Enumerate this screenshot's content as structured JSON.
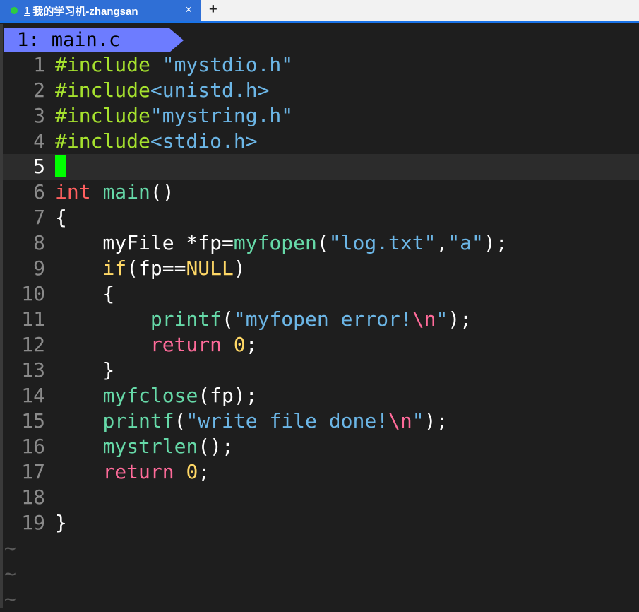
{
  "tabbar": {
    "tab_number": "1",
    "tab_title": "我的学习机-zhangsan",
    "close_glyph": "×",
    "add_glyph": "+",
    "status_dot_color": "#2ecc40"
  },
  "editor": {
    "file_tab": "1: main.c",
    "current_line": 5,
    "tilde_rows": [
      "~",
      "~",
      "~"
    ]
  },
  "code_lines": [
    {
      "n": "1",
      "tokens": [
        [
          "kw-inc",
          "#include "
        ],
        [
          "str",
          "\"mystdio.h\""
        ]
      ]
    },
    {
      "n": "2",
      "tokens": [
        [
          "kw-inc",
          "#include"
        ],
        [
          "str",
          "<unistd.h>"
        ]
      ]
    },
    {
      "n": "3",
      "tokens": [
        [
          "kw-inc",
          "#include"
        ],
        [
          "str",
          "\"mystring.h\""
        ]
      ]
    },
    {
      "n": "4",
      "tokens": [
        [
          "kw-inc",
          "#include"
        ],
        [
          "str",
          "<stdio.h>"
        ]
      ]
    },
    {
      "n": "5",
      "tokens": []
    },
    {
      "n": "6",
      "tokens": [
        [
          "type",
          "int"
        ],
        [
          "white",
          " "
        ],
        [
          "fn",
          "main"
        ],
        [
          "white",
          "()"
        ]
      ]
    },
    {
      "n": "7",
      "tokens": [
        [
          "white",
          "{"
        ]
      ]
    },
    {
      "n": "8",
      "tokens": [
        [
          "white",
          "    myFile *fp="
        ],
        [
          "fn",
          "myfopen"
        ],
        [
          "white",
          "("
        ],
        [
          "str",
          "\"log.txt\""
        ],
        [
          "white",
          ","
        ],
        [
          "str",
          "\"a\""
        ],
        [
          "white",
          ");"
        ]
      ]
    },
    {
      "n": "9",
      "tokens": [
        [
          "white",
          "    "
        ],
        [
          "ctl",
          "if"
        ],
        [
          "white",
          "(fp=="
        ],
        [
          "ctl",
          "NULL"
        ],
        [
          "white",
          ")"
        ]
      ]
    },
    {
      "n": "10",
      "tokens": [
        [
          "white",
          "    {"
        ]
      ]
    },
    {
      "n": "11",
      "tokens": [
        [
          "white",
          "        "
        ],
        [
          "fn",
          "printf"
        ],
        [
          "white",
          "("
        ],
        [
          "str",
          "\"myfopen error!"
        ],
        [
          "esc",
          "\\n"
        ],
        [
          "str",
          "\""
        ],
        [
          "white",
          ");"
        ]
      ]
    },
    {
      "n": "12",
      "tokens": [
        [
          "white",
          "        "
        ],
        [
          "ret",
          "return"
        ],
        [
          "white",
          " "
        ],
        [
          "num",
          "0"
        ],
        [
          "white",
          ";"
        ]
      ]
    },
    {
      "n": "13",
      "tokens": [
        [
          "white",
          "    }"
        ]
      ]
    },
    {
      "n": "14",
      "tokens": [
        [
          "white",
          "    "
        ],
        [
          "fn",
          "myfclose"
        ],
        [
          "white",
          "(fp);"
        ]
      ]
    },
    {
      "n": "15",
      "tokens": [
        [
          "white",
          "    "
        ],
        [
          "fn",
          "printf"
        ],
        [
          "white",
          "("
        ],
        [
          "str",
          "\"write file done!"
        ],
        [
          "esc",
          "\\n"
        ],
        [
          "str",
          "\""
        ],
        [
          "white",
          ");"
        ]
      ]
    },
    {
      "n": "16",
      "tokens": [
        [
          "white",
          "    "
        ],
        [
          "fn",
          "mystrlen"
        ],
        [
          "white",
          "();"
        ]
      ]
    },
    {
      "n": "17",
      "tokens": [
        [
          "white",
          "    "
        ],
        [
          "ret",
          "return"
        ],
        [
          "white",
          " "
        ],
        [
          "num",
          "0"
        ],
        [
          "white",
          ";"
        ]
      ]
    },
    {
      "n": "18",
      "tokens": []
    },
    {
      "n": "19",
      "tokens": [
        [
          "white",
          "}"
        ]
      ]
    }
  ]
}
